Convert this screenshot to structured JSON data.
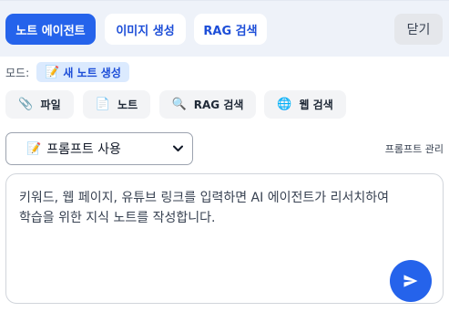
{
  "tabs": [
    {
      "label": "노트 에이전트",
      "active": true
    },
    {
      "label": "이미지 생성",
      "active": false
    },
    {
      "label": "RAG 검색",
      "active": false
    }
  ],
  "close_label": "닫기",
  "mode": {
    "label": "모드:",
    "value": "새 노트 생성",
    "icon": "pencil-memo-icon"
  },
  "sources": [
    {
      "label": "파일",
      "icon": "paperclip-icon"
    },
    {
      "label": "노트",
      "icon": "note-icon"
    },
    {
      "label": "RAG 검색",
      "icon": "magnifier-icon"
    },
    {
      "label": "웹 검색",
      "icon": "globe-icon"
    }
  ],
  "prompt_select": {
    "value": "프롬프트 사용",
    "icon": "pencil-memo-icon"
  },
  "prompt_manage": "프롬프트 관리",
  "input": {
    "placeholder": "키워드, 웹 페이지, 유튜브 링크를 입력하면 AI 에이전트가 리서치하여 학습을 위한 지식 노트를 작성합니다."
  },
  "colors": {
    "accent": "#2563eb",
    "accent_light": "#dbeafe",
    "topbar": "#eef2f9"
  }
}
